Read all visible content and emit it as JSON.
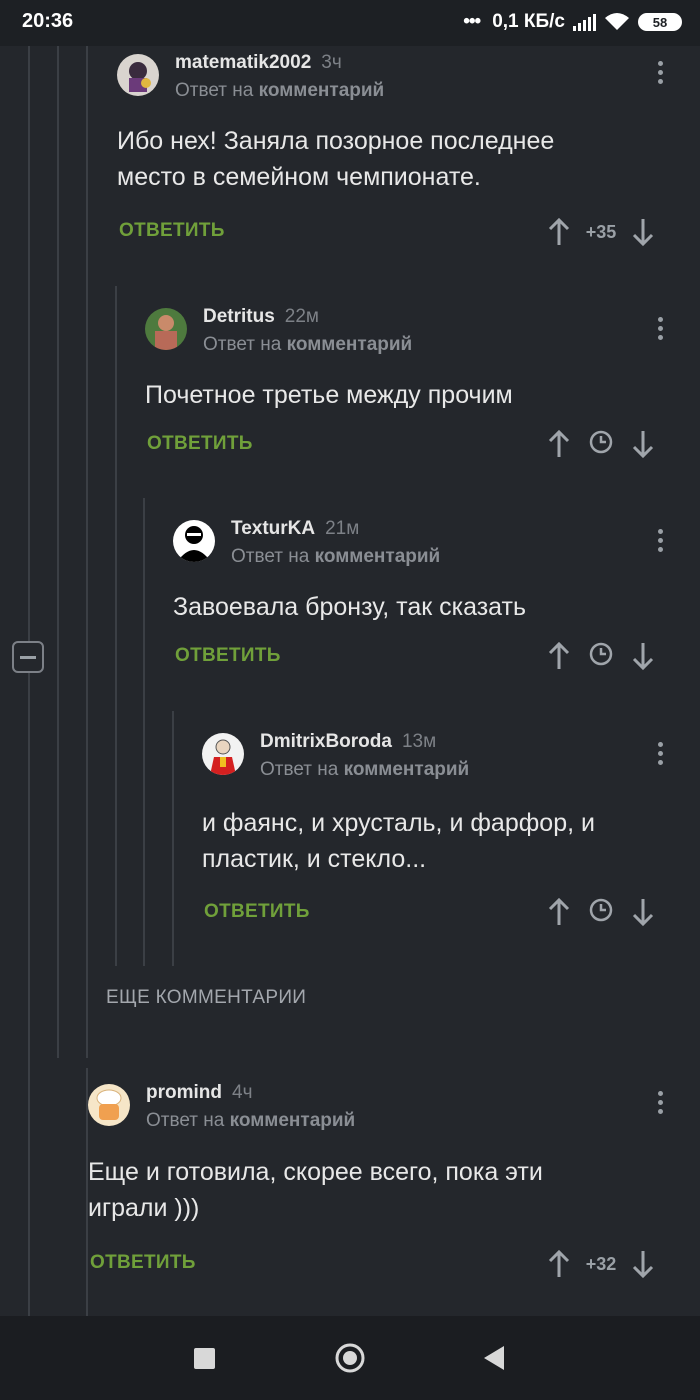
{
  "status_bar": {
    "time": "20:36",
    "network_speed": "0,1 КБ/с",
    "battery": "58"
  },
  "labels": {
    "reply_to_prefix": "Ответ на",
    "reply_to_target": "комментарий",
    "reply_button": "ОТВЕТИТЬ",
    "more_comments": "ЕЩЕ КОММЕНТАРИИ"
  },
  "comments": [
    {
      "username": "matematik2002",
      "time_ago": "3ч",
      "text_lines": [
        "Ибо нех! Заняла позорное последнее",
        "место в семейном чемпионате."
      ],
      "rating": "+35",
      "avatar_icon": "avatar-cartoon-icon"
    },
    {
      "username": "Detritus",
      "time_ago": "22м",
      "text_lines": [
        "Почетное третье между прочим"
      ],
      "rating": null,
      "rating_icon": "clock-icon",
      "avatar_icon": "avatar-photo-icon"
    },
    {
      "username": "TexturKA",
      "time_ago": "21м",
      "text_lines": [
        "Завоевала бронзу, так сказать"
      ],
      "rating": null,
      "rating_icon": "clock-icon",
      "avatar_icon": "avatar-silhouette-icon"
    },
    {
      "username": "DmitrixBoroda",
      "time_ago": "13м",
      "text_lines": [
        "и фаянс, и хрусталь, и фарфор, и",
        "пластик, и стекло..."
      ],
      "rating": null,
      "rating_icon": "clock-icon",
      "avatar_icon": "avatar-drawing-icon"
    },
    {
      "username": "promind",
      "time_ago": "4ч",
      "text_lines": [
        "Еще и готовила, скорее всего, пока эти",
        "играли )))"
      ],
      "rating": "+32",
      "avatar_icon": "avatar-chef-icon"
    }
  ],
  "colors": {
    "background": "#24272c",
    "accent_green": "#70a03a",
    "muted": "#8a8e94"
  }
}
